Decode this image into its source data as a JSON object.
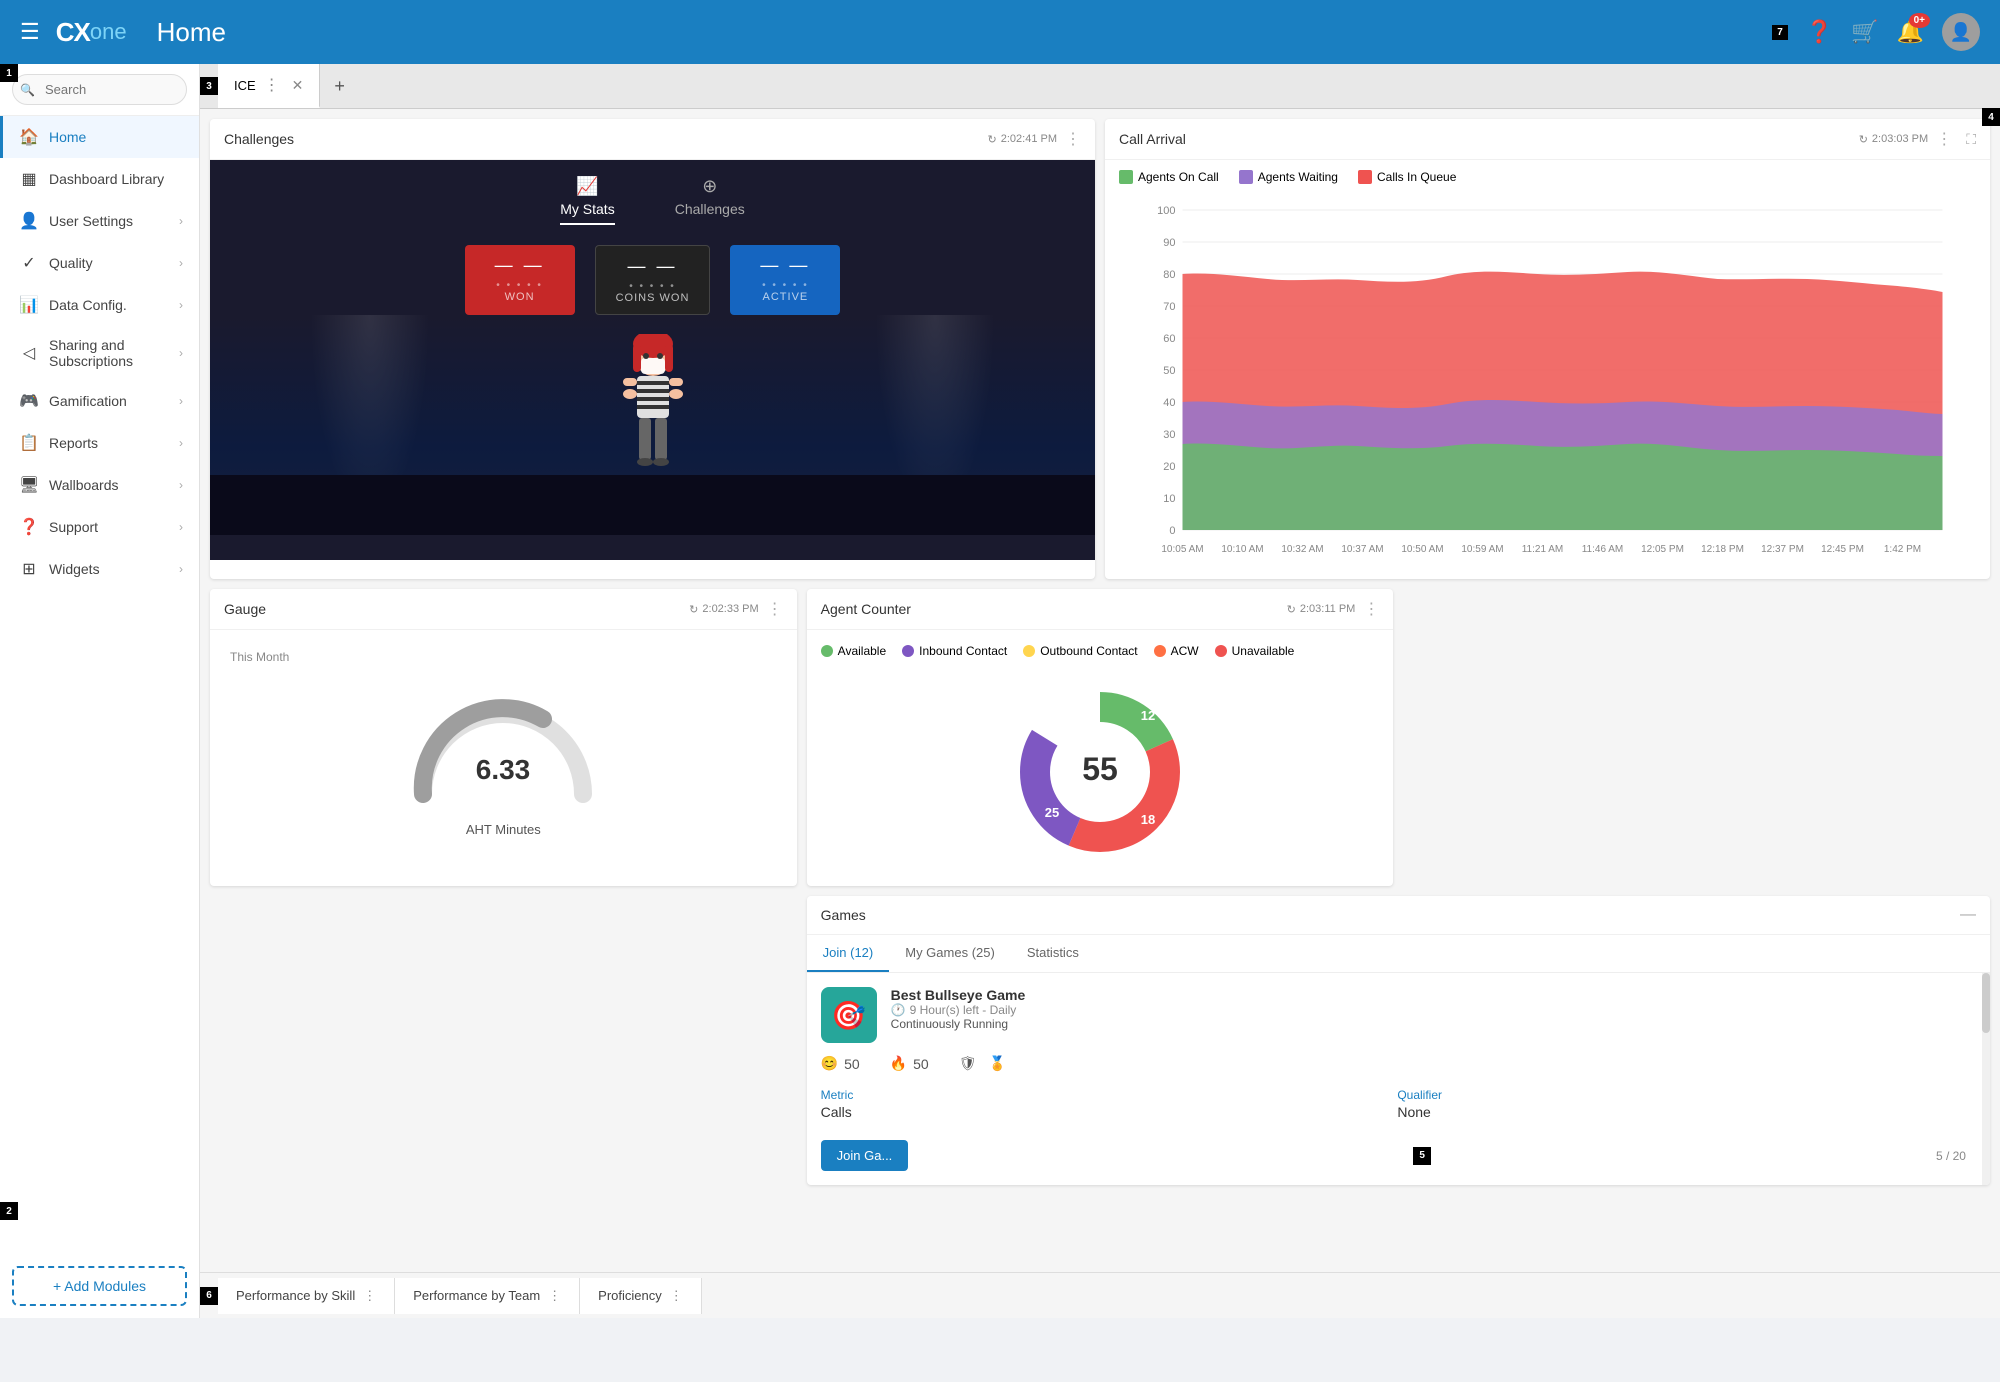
{
  "app": {
    "title": "Home",
    "logo_cx": "CX",
    "logo_one": "one"
  },
  "nav_icons": {
    "badge_7": "7",
    "badge_notifications": "0+"
  },
  "sidebar": {
    "search_placeholder": "Search",
    "items": [
      {
        "id": "home",
        "label": "Home",
        "icon": "🏠",
        "active": true
      },
      {
        "id": "dashboard-library",
        "label": "Dashboard Library",
        "icon": "▦"
      },
      {
        "id": "user-settings",
        "label": "User Settings",
        "icon": "👤"
      },
      {
        "id": "quality",
        "label": "Quality",
        "icon": "✓"
      },
      {
        "id": "data-config",
        "label": "Data Config.",
        "icon": "📊"
      },
      {
        "id": "sharing",
        "label": "Sharing and Subscriptions",
        "icon": "◁"
      },
      {
        "id": "gamification",
        "label": "Gamification",
        "icon": "🎮"
      },
      {
        "id": "reports",
        "label": "Reports",
        "icon": "📋"
      },
      {
        "id": "wallboards",
        "label": "Wallboards",
        "icon": "🖥"
      },
      {
        "id": "support",
        "label": "Support",
        "icon": "❓"
      },
      {
        "id": "widgets",
        "label": "Widgets",
        "icon": "⊞"
      }
    ],
    "add_modules_label": "+ Add Modules"
  },
  "tab_bar": {
    "tabs": [
      {
        "label": "ICE",
        "active": true
      }
    ],
    "add_icon": "+"
  },
  "challenges_card": {
    "title": "Challenges",
    "refresh_time": "2:02:41 PM",
    "tabs": [
      {
        "label": "My Stats",
        "active": true,
        "icon": "📈"
      },
      {
        "label": "Challenges",
        "active": false,
        "icon": "⊕"
      }
    ],
    "stat_boxes": [
      {
        "label": "WON",
        "value": "—",
        "dots": "•••••",
        "color": "red"
      },
      {
        "label": "COINS WON",
        "value": "—",
        "dots": "•••••",
        "color": "dark"
      },
      {
        "label": "ACTIVE",
        "value": "—",
        "dots": "•••••",
        "color": "blue"
      }
    ]
  },
  "call_arrival_card": {
    "title": "Call Arrival",
    "refresh_time": "2:03:03 PM",
    "legend": [
      {
        "label": "Agents On Call",
        "color": "#66bb6a"
      },
      {
        "label": "Agents Waiting",
        "color": "#9575cd"
      },
      {
        "label": "Calls In Queue",
        "color": "#ef5350"
      }
    ],
    "y_labels": [
      "100",
      "90",
      "80",
      "70",
      "60",
      "50",
      "40",
      "30",
      "20",
      "10",
      "0"
    ],
    "x_labels": [
      "10:05 AM",
      "10:10 AM",
      "10:32 AM",
      "10:37 AM",
      "10:50 AM",
      "10:59 AM",
      "11:21 AM",
      "11:46 AM",
      "12:05 PM",
      "12:18 PM",
      "12:37 PM",
      "12:45 PM",
      "1:42 PM"
    ]
  },
  "gauge_card": {
    "title": "Gauge",
    "refresh_time": "2:02:33 PM",
    "subtitle": "This Month",
    "value": "6.33",
    "label": "AHT Minutes"
  },
  "agent_counter_card": {
    "title": "Agent Counter",
    "refresh_time": "2:03:11 PM",
    "legend": [
      {
        "label": "Available",
        "color": "#66bb6a"
      },
      {
        "label": "Inbound Contact",
        "color": "#7e57c2"
      },
      {
        "label": "Outbound Contact",
        "color": "#ffd54f"
      },
      {
        "label": "ACW",
        "color": "#ff7043"
      },
      {
        "label": "Unavailable",
        "color": "#ef5350"
      }
    ],
    "total": "55",
    "segments": [
      {
        "value": 12,
        "color": "#66bb6a",
        "label": "12"
      },
      {
        "value": 18,
        "color": "#7e57c2",
        "label": "18"
      },
      {
        "value": 25,
        "color": "#ef5350",
        "label": "25"
      }
    ]
  },
  "games_card": {
    "title": "Games",
    "tabs": [
      {
        "label": "Join (12)",
        "active": true
      },
      {
        "label": "My Games (25)",
        "active": false
      },
      {
        "label": "Statistics",
        "active": false
      }
    ],
    "game": {
      "name": "Best Bullseye Game",
      "time_left": "9 Hour(s) left - Daily",
      "status": "Continuously Running",
      "stats": [
        {
          "icon": "😊",
          "value": "50"
        },
        {
          "icon": "🔥",
          "value": "50"
        },
        {
          "icon": "🛡",
          "value": ""
        },
        {
          "icon": "🏅",
          "value": ""
        }
      ],
      "metric_label": "Metric",
      "metric_value": "Calls",
      "qualifier_label": "Qualifier",
      "qualifier_value": "None",
      "join_btn": "Join Ga...",
      "page": "5 / 20"
    }
  },
  "bottom_tabs": [
    {
      "label": "Performance by Skill",
      "has_menu": true
    },
    {
      "label": "Performance by Team",
      "has_menu": true
    },
    {
      "label": "Proficiency",
      "has_menu": true
    }
  ],
  "corner_badges": {
    "b1": "1",
    "b2": "2",
    "b3": "3",
    "b4": "4",
    "b5": "5",
    "b6": "6",
    "b7": "7"
  }
}
